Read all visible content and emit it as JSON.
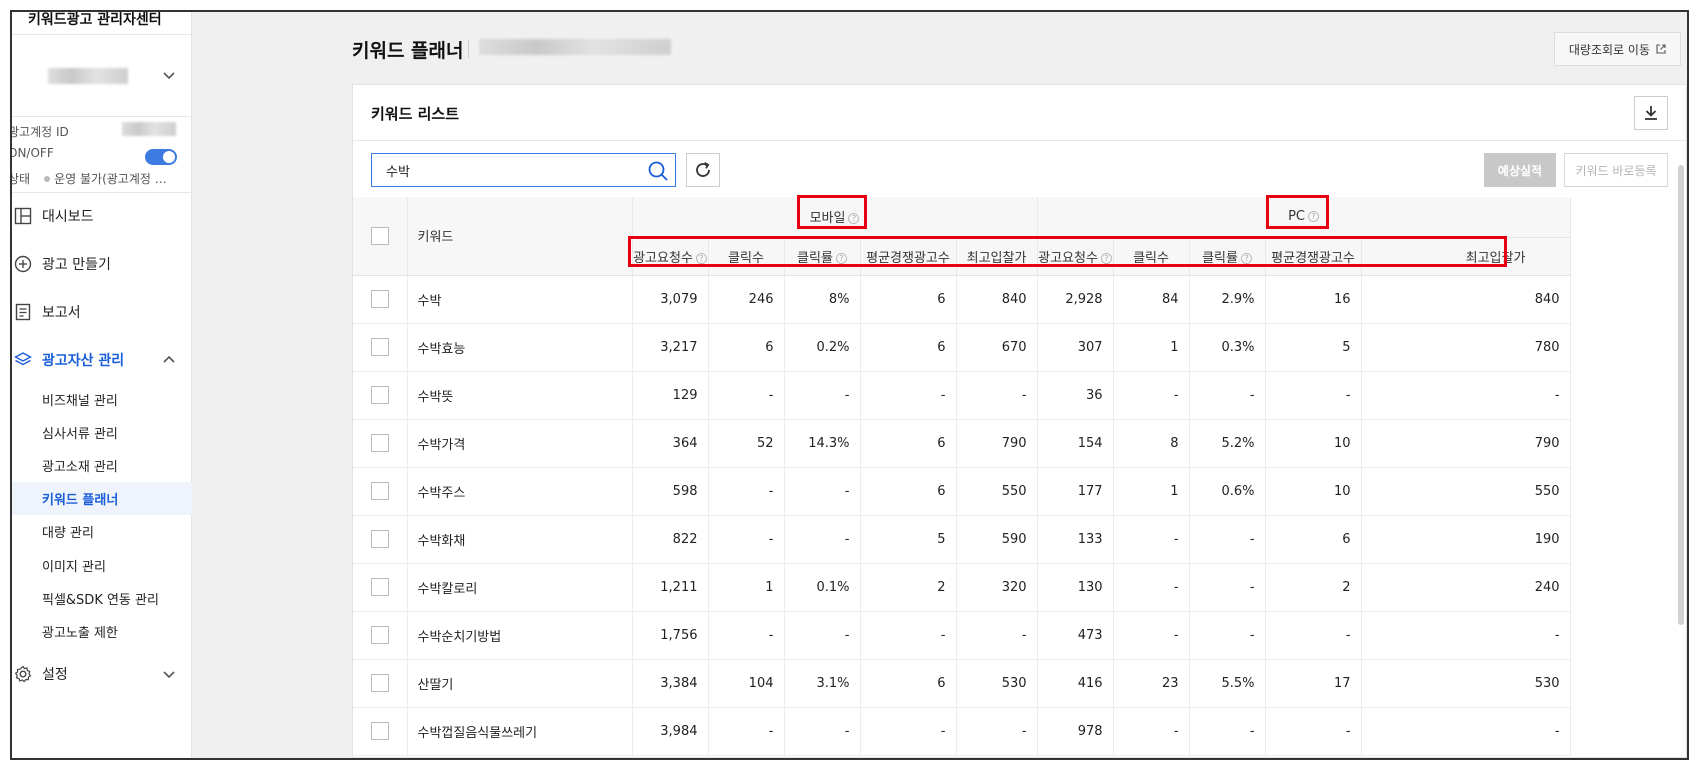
{
  "sidebar": {
    "title": "키워드광고 관리자센터",
    "account_id_label": "광고계정 ID",
    "onoff_label": "ON/OFF",
    "status_label": "상태",
    "status_value": "운영 불가(광고계정 …",
    "nav": [
      {
        "label": "대시보드",
        "icon": "dashboard-icon"
      },
      {
        "label": "광고 만들기",
        "icon": "plus-circle-icon"
      },
      {
        "label": "보고서",
        "icon": "report-icon"
      },
      {
        "label": "광고자산 관리",
        "icon": "layers-icon"
      }
    ],
    "sub_items": [
      {
        "label": "비즈채널 관리"
      },
      {
        "label": "심사서류 관리"
      },
      {
        "label": "광고소재 관리"
      },
      {
        "label": "키워드 플래너"
      },
      {
        "label": "대량 관리"
      },
      {
        "label": "이미지 관리"
      },
      {
        "label": "픽셀&SDK 연동 관리"
      },
      {
        "label": "광고노출 제한"
      }
    ],
    "settings_label": "설정"
  },
  "header": {
    "title": "키워드 플래너",
    "bulk_button": "대량조회로 이동"
  },
  "panel": {
    "title": "키워드 리스트",
    "search_value": "수박",
    "predict_button": "예상실적",
    "register_button": "키워드 바로등록"
  },
  "table": {
    "keyword_header": "키워드",
    "group_mobile": "모바일",
    "group_pc": "PC",
    "cols": {
      "requests": "광고요청수",
      "clicks": "클릭수",
      "ctr": "클릭률",
      "competitors": "평균경쟁광고수",
      "bid": "최고입찰가"
    },
    "rows": [
      {
        "kw": "수박",
        "m": [
          "3,079",
          "246",
          "8%",
          "6",
          "840"
        ],
        "p": [
          "2,928",
          "84",
          "2.9%",
          "16",
          "840"
        ]
      },
      {
        "kw": "수박효능",
        "m": [
          "3,217",
          "6",
          "0.2%",
          "6",
          "670"
        ],
        "p": [
          "307",
          "1",
          "0.3%",
          "5",
          "780"
        ]
      },
      {
        "kw": "수박뜻",
        "m": [
          "129",
          "-",
          "-",
          "-",
          "-"
        ],
        "p": [
          "36",
          "-",
          "-",
          "-",
          "-"
        ]
      },
      {
        "kw": "수박가격",
        "m": [
          "364",
          "52",
          "14.3%",
          "6",
          "790"
        ],
        "p": [
          "154",
          "8",
          "5.2%",
          "10",
          "790"
        ]
      },
      {
        "kw": "수박주스",
        "m": [
          "598",
          "-",
          "-",
          "6",
          "550"
        ],
        "p": [
          "177",
          "1",
          "0.6%",
          "10",
          "550"
        ]
      },
      {
        "kw": "수박화채",
        "m": [
          "822",
          "-",
          "-",
          "5",
          "590"
        ],
        "p": [
          "133",
          "-",
          "-",
          "6",
          "190"
        ]
      },
      {
        "kw": "수박칼로리",
        "m": [
          "1,211",
          "1",
          "0.1%",
          "2",
          "320"
        ],
        "p": [
          "130",
          "-",
          "-",
          "2",
          "240"
        ]
      },
      {
        "kw": "수박순치기방법",
        "m": [
          "1,756",
          "-",
          "-",
          "-",
          "-"
        ],
        "p": [
          "473",
          "-",
          "-",
          "-",
          "-"
        ]
      },
      {
        "kw": "산딸기",
        "m": [
          "3,384",
          "104",
          "3.1%",
          "6",
          "530"
        ],
        "p": [
          "416",
          "23",
          "5.5%",
          "17",
          "530"
        ]
      },
      {
        "kw": "수박껍질음식물쓰레기",
        "m": [
          "3,984",
          "-",
          "-",
          "-",
          "-"
        ],
        "p": [
          "978",
          "-",
          "-",
          "-",
          "-"
        ]
      }
    ]
  },
  "colors": {
    "accent": "#1a5dd9",
    "toggle_on": "#3d7be3",
    "highlight_box": "#e60012"
  }
}
